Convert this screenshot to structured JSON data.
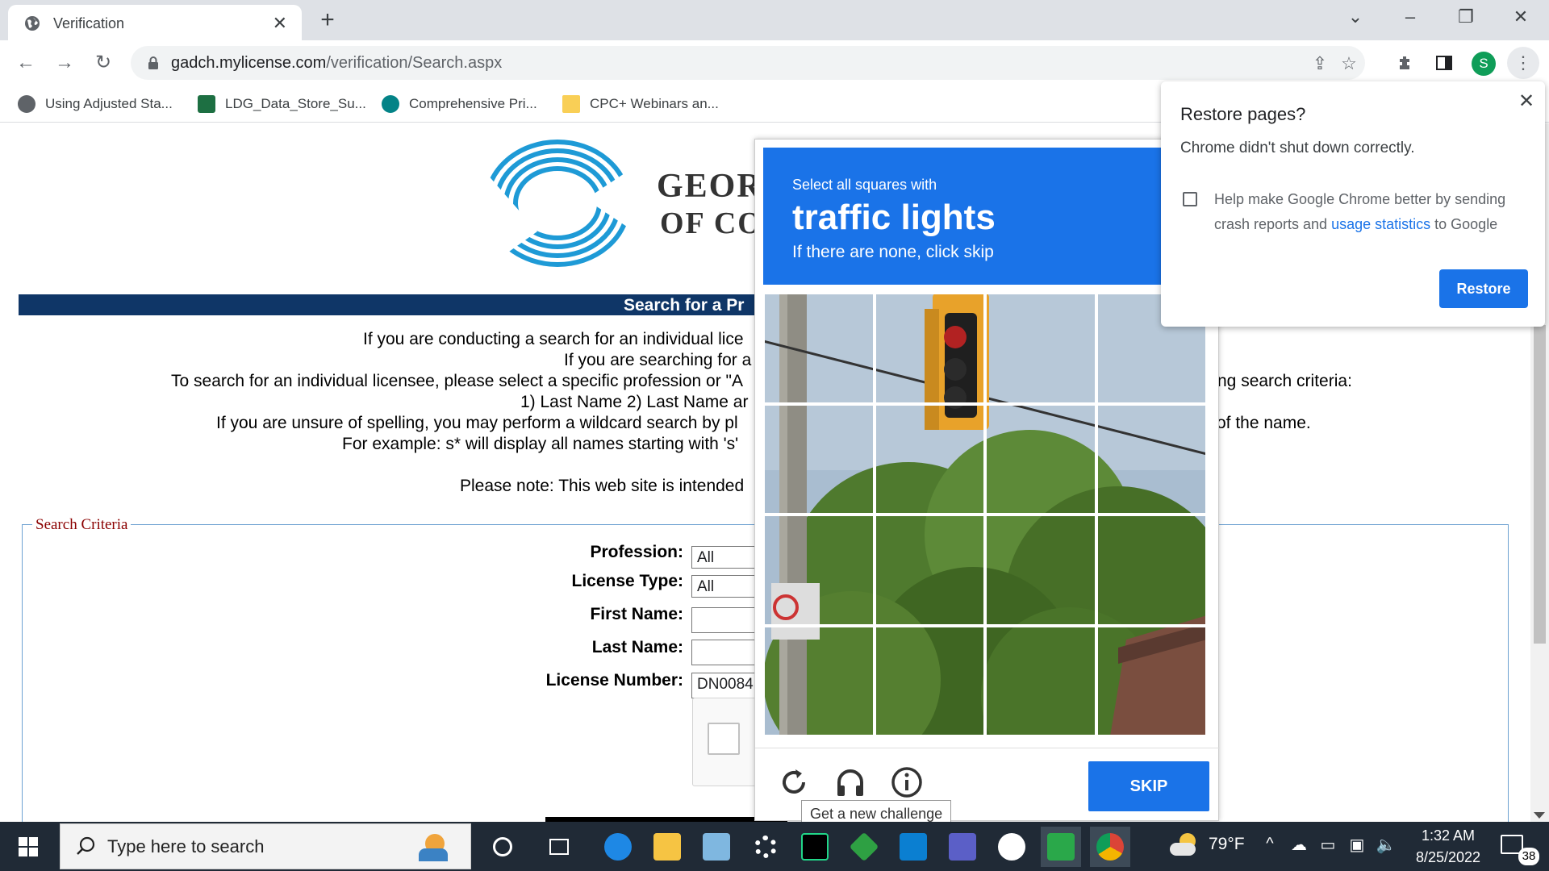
{
  "browser": {
    "tab_title": "Verification",
    "url_host": "gadch.mylicense.com",
    "url_path": "/verification/Search.aspx",
    "bookmarks": [
      {
        "label": "Using Adjusted Sta...",
        "icon": "globe-icon"
      },
      {
        "label": "LDG_Data_Store_Su...",
        "icon": "excel-icon"
      },
      {
        "label": "Comprehensive Pri...",
        "icon": "sharepoint-icon"
      },
      {
        "label": "CPC+ Webinars an...",
        "icon": "folder-icon"
      }
    ],
    "profile_initial": "S"
  },
  "page": {
    "logo_line1": "GEOR",
    "logo_line2": "OF CO",
    "banner_title": "Search for a Pr",
    "intro_lines": [
      "If you are conducting a search for an individual lice",
      "If you are searching for a",
      "To search for an individual licensee, please select a specific profession or \"A",
      "ng search criteria:",
      "1) Last Name 2) Last Name ar",
      "If you are unsure of spelling, you may perform a wildcard search by pl",
      "of the name.",
      "For example: s* will display all names starting with 's'",
      "Please note: This web site is intended"
    ],
    "search_criteria_legend": "Search Criteria",
    "fields": {
      "profession_label": "Profession:",
      "profession_value": "All",
      "license_type_label": "License Type:",
      "license_type_value": "All",
      "first_name_label": "First Name:",
      "first_name_value": "",
      "last_name_label": "Last Name:",
      "last_name_value": "",
      "license_number_label": "License Number:",
      "license_number_value": "DN0084"
    }
  },
  "captcha": {
    "instruction_line1": "Select all squares with",
    "target": "traffic lights",
    "instruction_line3": "If there are none, click skip",
    "skip_label": "SKIP",
    "tooltip": "Get a new challenge",
    "accent": "#1a73e8"
  },
  "restore_popup": {
    "title": "Restore pages?",
    "message": "Chrome didn't shut down correctly.",
    "checkbox_text_part1": "Help make Google Chrome better by sending crash reports and ",
    "checkbox_link": "usage statistics",
    "checkbox_text_part2": " to Google",
    "restore_label": "Restore"
  },
  "taskbar": {
    "search_placeholder": "Type here to search",
    "weather": "79°F",
    "time": "1:32 AM",
    "date": "8/25/2022",
    "notification_count": "38"
  }
}
